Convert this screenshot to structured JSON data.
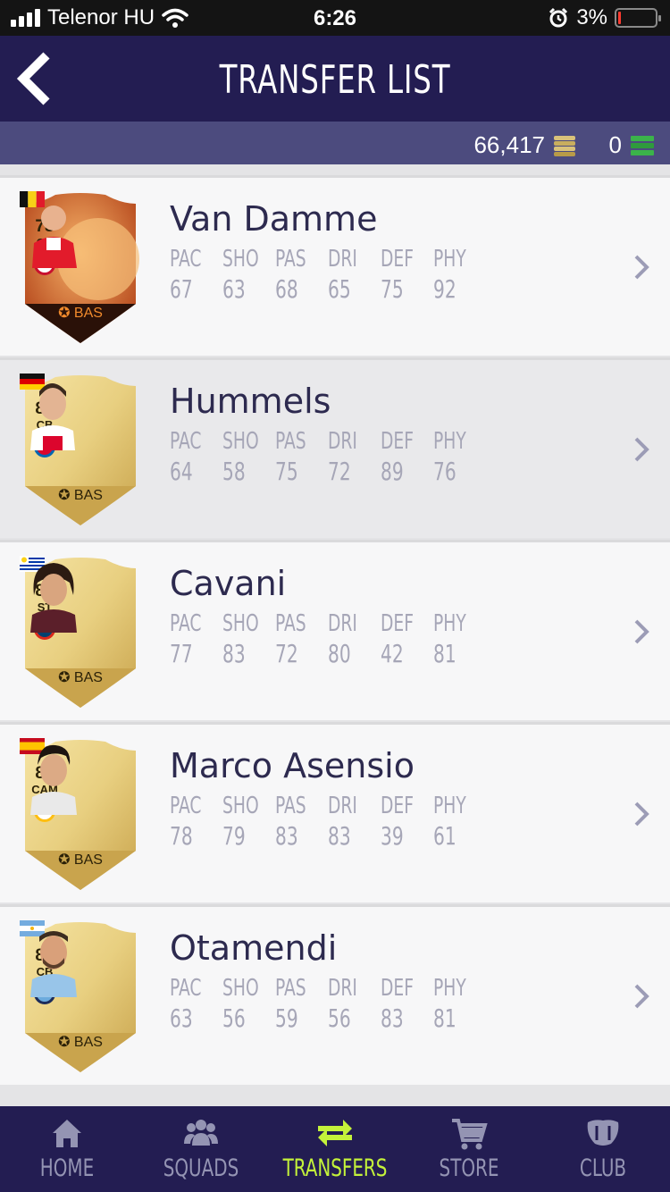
{
  "status_bar": {
    "carrier": "Telenor HU",
    "time": "6:26",
    "battery": "3%"
  },
  "header": {
    "title": "TRANSFER LIST"
  },
  "currency": {
    "coins": "66,417",
    "points": "0"
  },
  "stat_labels": [
    "PAC",
    "SHO",
    "PAS",
    "DRI",
    "DEF",
    "PHY"
  ],
  "players": [
    {
      "name": "Van Damme",
      "rating": "78",
      "position": "CB",
      "chem": "BAS",
      "stats": [
        "67",
        "63",
        "68",
        "65",
        "75",
        "92"
      ],
      "card": "halloween"
    },
    {
      "name": "Hummels",
      "rating": "88",
      "position": "CB",
      "chem": "BAS",
      "stats": [
        "64",
        "58",
        "75",
        "72",
        "89",
        "76"
      ],
      "card": "gold"
    },
    {
      "name": "Cavani",
      "rating": "87",
      "position": "ST",
      "chem": "BAS",
      "stats": [
        "77",
        "83",
        "72",
        "80",
        "42",
        "81"
      ],
      "card": "gold"
    },
    {
      "name": "Marco Asensio",
      "rating": "84",
      "position": "CAM",
      "chem": "BAS",
      "stats": [
        "78",
        "79",
        "83",
        "83",
        "39",
        "61"
      ],
      "card": "gold"
    },
    {
      "name": "Otamendi",
      "rating": "83",
      "position": "CB",
      "chem": "BAS",
      "stats": [
        "63",
        "56",
        "59",
        "56",
        "83",
        "81"
      ],
      "card": "gold"
    }
  ],
  "tabs": [
    {
      "label": "HOME",
      "icon": "home-icon"
    },
    {
      "label": "SQUADS",
      "icon": "squads-icon"
    },
    {
      "label": "TRANSFERS",
      "icon": "transfers-icon",
      "active": true
    },
    {
      "label": "STORE",
      "icon": "store-icon"
    },
    {
      "label": "CLUB",
      "icon": "club-icon"
    }
  ]
}
